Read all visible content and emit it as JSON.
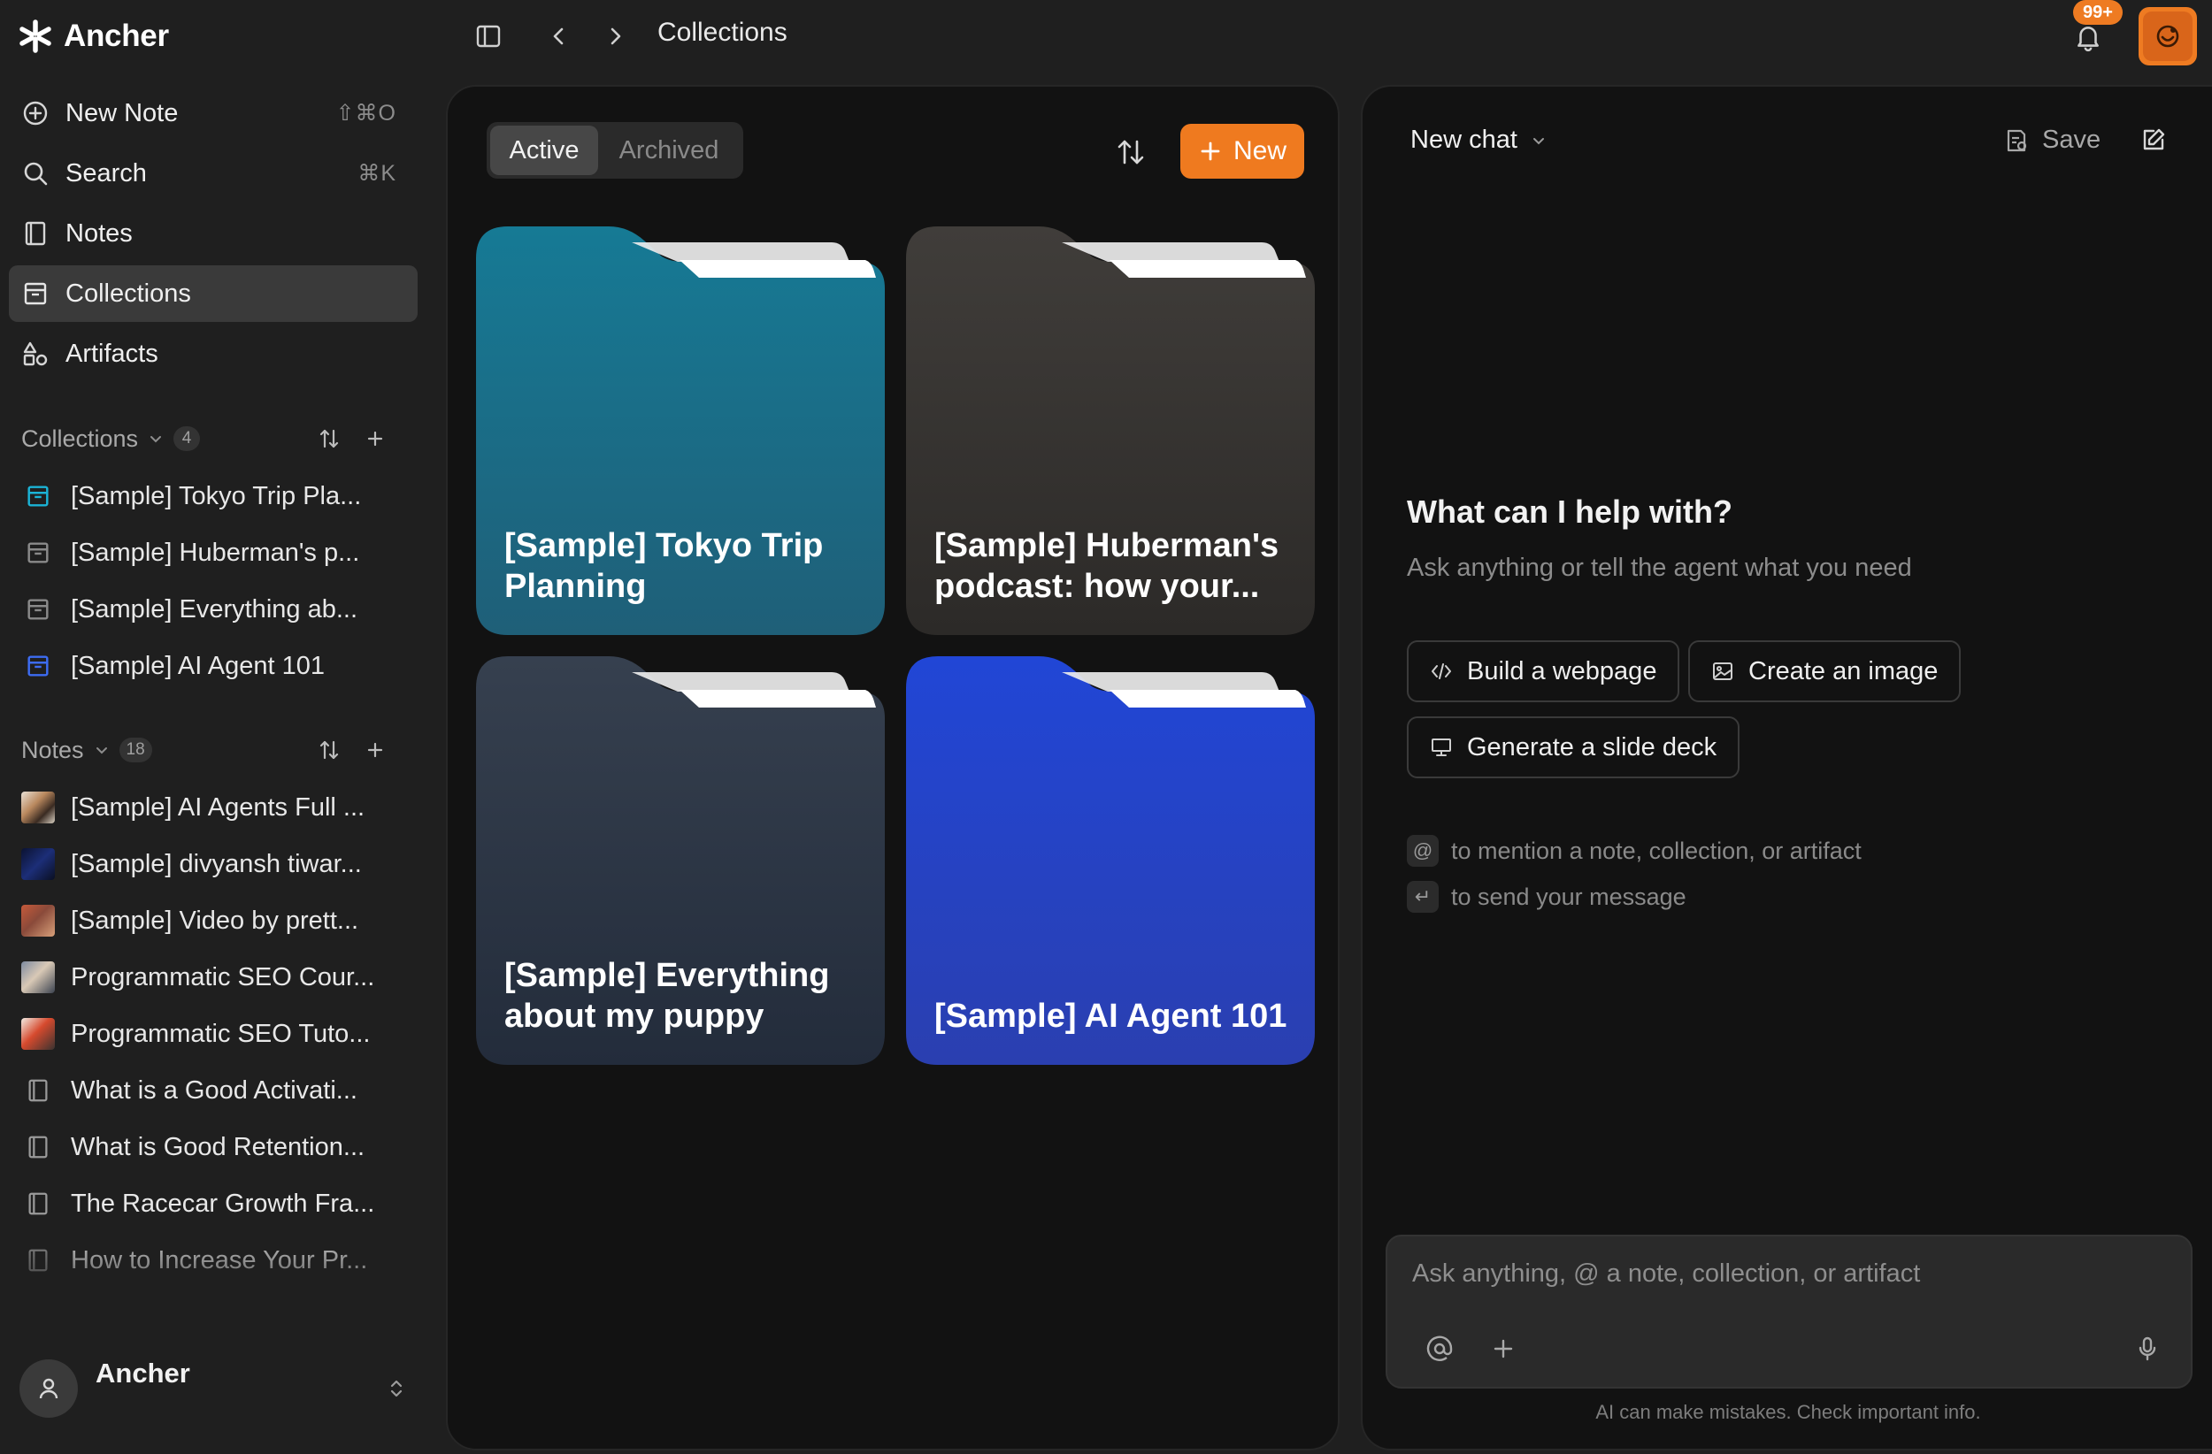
{
  "app": {
    "name": "Ancher"
  },
  "breadcrumb": "Collections",
  "notifications": {
    "badge": "99+"
  },
  "sidebar": {
    "nav": [
      {
        "label": "New Note",
        "shortcut": "⇧⌘O",
        "icon": "plus-circle-icon"
      },
      {
        "label": "Search",
        "shortcut": "⌘K",
        "icon": "search-icon"
      },
      {
        "label": "Notes",
        "shortcut": "",
        "icon": "notebook-icon"
      },
      {
        "label": "Collections",
        "shortcut": "",
        "icon": "archive-box-icon",
        "active": true
      },
      {
        "label": "Artifacts",
        "shortcut": "",
        "icon": "shapes-icon"
      }
    ],
    "collections": {
      "title": "Collections",
      "count": "4",
      "items": [
        {
          "label": "[Sample] Tokyo Trip Pla...",
          "color": "#1bb3d6"
        },
        {
          "label": "[Sample] Huberman's p...",
          "color": "#8a8a8a"
        },
        {
          "label": "[Sample] Everything ab...",
          "color": "#8a8a8a"
        },
        {
          "label": "[Sample] AI Agent 101",
          "color": "#3d6cf2"
        }
      ]
    },
    "notes": {
      "title": "Notes",
      "count": "18",
      "items": [
        {
          "label": "[Sample] AI Agents Full ...",
          "thumb": "video-thumb"
        },
        {
          "label": "[Sample] divyansh tiwar...",
          "thumb": "video-thumb"
        },
        {
          "label": "[Sample] Video by prett...",
          "thumb": "video-thumb"
        },
        {
          "label": "Programmatic SEO Cour...",
          "thumb": "video-thumb"
        },
        {
          "label": "Programmatic SEO Tuto...",
          "thumb": "video-thumb"
        },
        {
          "label": "What is a Good Activati...",
          "thumb": "notebook-icon"
        },
        {
          "label": "What is Good Retention...",
          "thumb": "notebook-icon"
        },
        {
          "label": "The Racecar Growth Fra...",
          "thumb": "notebook-icon"
        },
        {
          "label": "How to Increase Your Pr...",
          "thumb": "notebook-icon"
        }
      ]
    },
    "user": {
      "name": "Ancher"
    }
  },
  "collections_view": {
    "tabs": [
      {
        "label": "Active",
        "selected": true
      },
      {
        "label": "Archived",
        "selected": false
      }
    ],
    "new_label": "New",
    "folders": [
      {
        "title": "[Sample] Tokyo Trip Planning",
        "color_top": "#167a95",
        "color_bottom": "#1f5f78"
      },
      {
        "title": "[Sample] Huberman's podcast: how your...",
        "color_top": "#403d3a",
        "color_bottom": "#2c2a28"
      },
      {
        "title": "[Sample] Everything about my puppy",
        "color_top": "#36404f",
        "color_bottom": "#232c3b"
      },
      {
        "title": "[Sample] AI Agent 101",
        "color_top": "#2146d6",
        "color_bottom": "#2a3fb0"
      }
    ]
  },
  "chat": {
    "title": "New chat",
    "save_label": "Save",
    "heading": "What can I help with?",
    "subheading": "Ask anything or tell the agent what you need",
    "suggestions": [
      {
        "label": "Build a webpage",
        "icon": "code-icon"
      },
      {
        "label": "Create an image",
        "icon": "image-icon"
      },
      {
        "label": "Generate a slide deck",
        "icon": "presentation-icon"
      }
    ],
    "hints": [
      {
        "key": "@",
        "text": "to mention a note, collection, or artifact"
      },
      {
        "key": "↵",
        "text": "to send your message"
      }
    ],
    "input_placeholder": "Ask anything, @ a note, collection, or artifact",
    "disclaimer": "AI can make mistakes. Check important info."
  },
  "colors": {
    "accent": "#ef7a1f",
    "background": "#1f1f1f",
    "panel": "#121212"
  }
}
